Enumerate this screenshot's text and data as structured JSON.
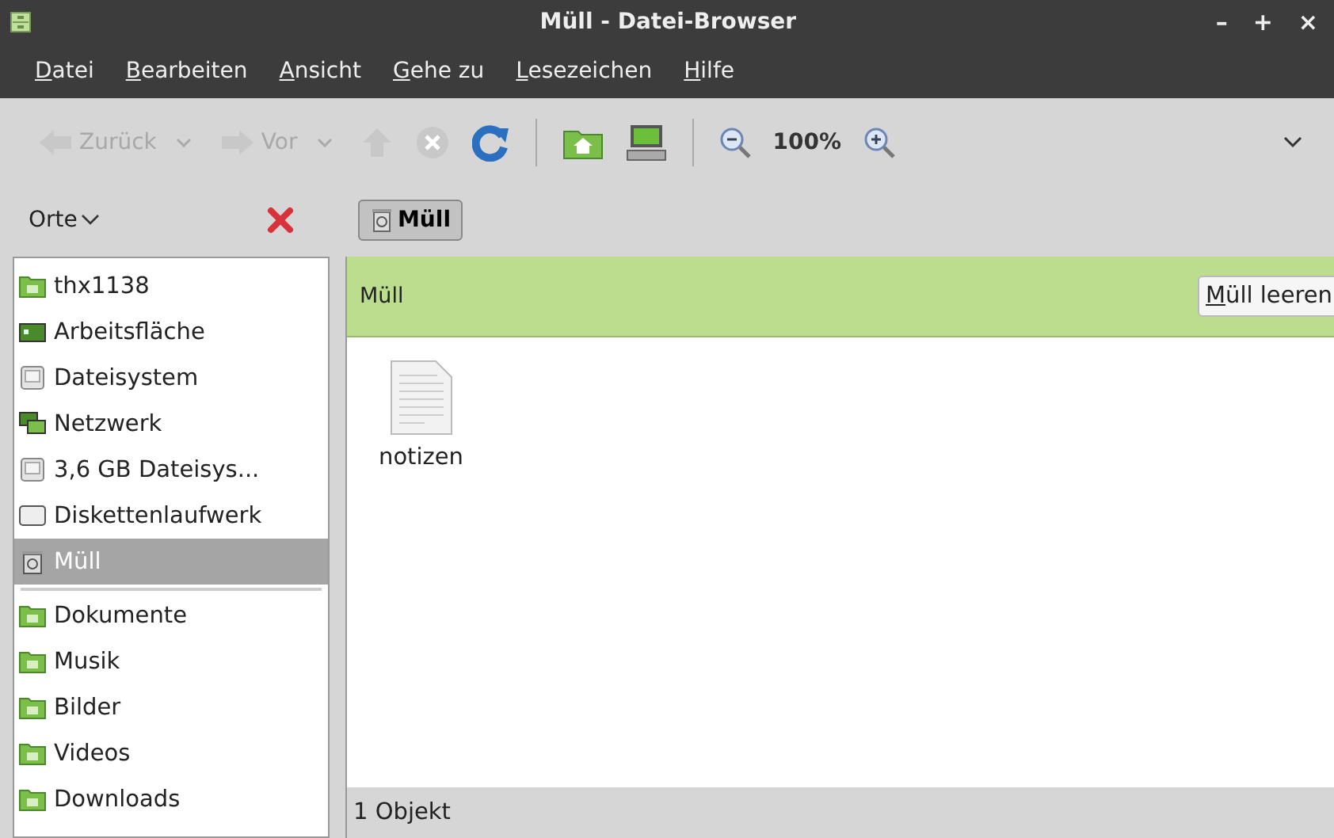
{
  "window": {
    "title": "Müll - Datei-Browser",
    "controls": [
      "–",
      "+",
      "×"
    ]
  },
  "menu": [
    "Datei",
    "Bearbeiten",
    "Ansicht",
    "Gehe zu",
    "Lesezeichen",
    "Hilfe"
  ],
  "toolbar": [
    {
      "kind": "back",
      "label": "Zurück",
      "disabled": true
    },
    {
      "kind": "forward",
      "label": "Vor",
      "disabled": true
    },
    {
      "kind": "up",
      "disabled": true
    },
    {
      "kind": "stop",
      "disabled": true
    },
    {
      "kind": "reload",
      "disabled": false
    },
    {
      "kind": "sep"
    },
    {
      "kind": "home"
    },
    {
      "kind": "computer"
    },
    {
      "kind": "sep"
    },
    {
      "kind": "zoom-out"
    },
    {
      "kind": "zoom-level",
      "label": "100%"
    },
    {
      "kind": "zoom-in"
    }
  ],
  "places": {
    "label": "Orte"
  },
  "path": [
    {
      "label": "Müll",
      "selected": true
    }
  ],
  "sidebar": {
    "items": [
      {
        "label": "thx1138",
        "kind": "home",
        "selected": false
      },
      {
        "label": "Arbeitsfläche",
        "kind": "desktop",
        "selected": false
      },
      {
        "label": "Dateisystem",
        "kind": "drive",
        "selected": false
      },
      {
        "label": "Netzwerk",
        "kind": "network",
        "selected": false
      },
      {
        "label": "3,6 GB Dateisys...",
        "kind": "drive",
        "selected": false
      },
      {
        "label": "Diskettenlaufwerk",
        "kind": "floppy",
        "selected": false
      },
      {
        "label": "Müll",
        "kind": "trash",
        "selected": true
      },
      {
        "kind": "separator"
      },
      {
        "label": "Dokumente",
        "kind": "folder",
        "selected": false
      },
      {
        "label": "Musik",
        "kind": "folder",
        "selected": false
      },
      {
        "label": "Bilder",
        "kind": "folder",
        "selected": false
      },
      {
        "label": "Videos",
        "kind": "folder",
        "selected": false
      },
      {
        "label": "Downloads",
        "kind": "folder",
        "selected": false
      }
    ]
  },
  "banner": {
    "title": "Müll",
    "button": "Müll leeren"
  },
  "files": [
    {
      "name": "notizen",
      "kind": "text"
    }
  ],
  "status_bar": "1 Objekt"
}
